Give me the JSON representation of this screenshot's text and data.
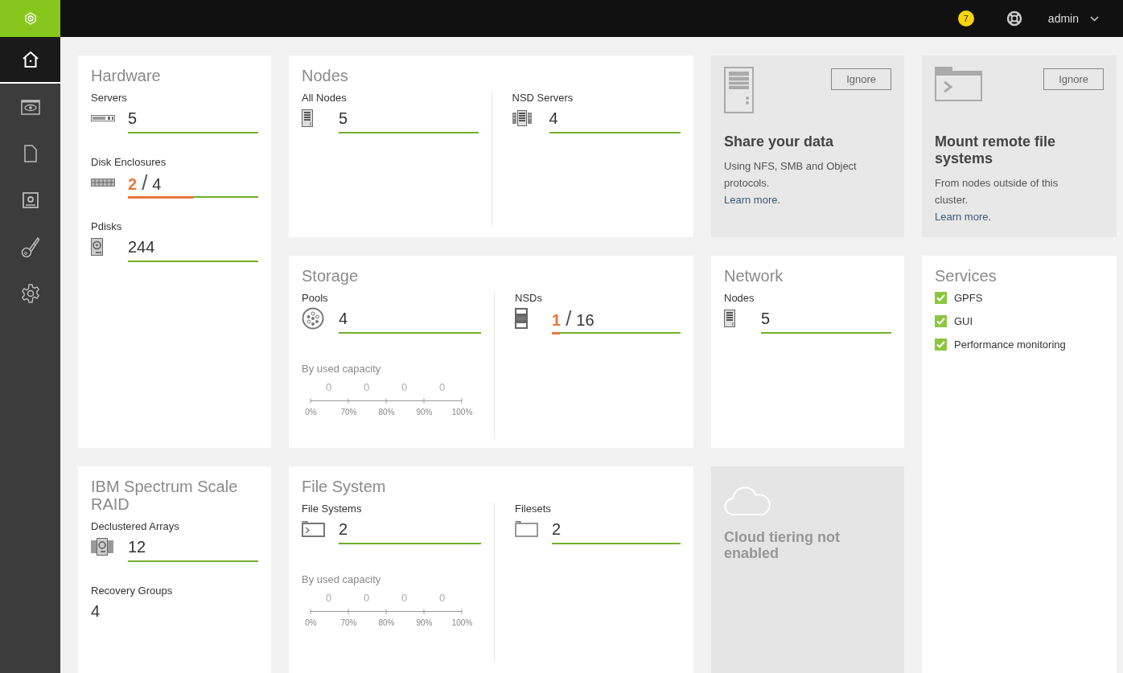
{
  "topbar": {
    "notification_count": "7",
    "user": "admin"
  },
  "sidebar": {
    "items": [
      {
        "selected": true
      },
      {
        "selected": false
      },
      {
        "selected": false
      },
      {
        "selected": false
      },
      {
        "selected": false
      },
      {
        "selected": false
      }
    ]
  },
  "cards": [
    {
      "kind": "metrics",
      "title": "Hardware",
      "metrics": [
        {
          "label": "Servers",
          "value": "5",
          "bar": true
        },
        {
          "label": "Disk Enclosures",
          "value": "2",
          "divider": "/",
          "total": "4",
          "level": 0.5,
          "bar": true
        },
        {
          "label": "Pdisks",
          "value": "244",
          "bar": true
        }
      ]
    },
    {
      "kind": "split",
      "title": "Nodes",
      "metrics": [
        {
          "label": "All Nodes",
          "value": "5",
          "bar": true
        },
        {
          "label": "NSD Servers",
          "value": "4",
          "bar": true
        }
      ]
    },
    {
      "kind": "promo",
      "title": "Share your data",
      "text": "Using NFS, SMB and Object protocols.",
      "link": "Learn more.",
      "button": "Ignore"
    },
    {
      "kind": "promo",
      "title": "Mount remote file systems",
      "text": "From nodes outside of this cluster.",
      "link": "Learn more.",
      "button": "Ignore"
    },
    {
      "kind": "split",
      "title": "Storage",
      "metrics": [
        {
          "label": "Pools",
          "value": "4",
          "bar": true,
          "histogram": {
            "title": "By used capacity",
            "counts": [
              "0",
              "0",
              "0",
              "0"
            ],
            "ticks": [
              "0%",
              "70%",
              "80%",
              "90%",
              "100%"
            ]
          }
        },
        {
          "label": "NSDs",
          "value": "1",
          "divider": "/",
          "total": "16",
          "level": 0.0625,
          "bar": true
        }
      ]
    },
    {
      "kind": "metrics",
      "title": "Network",
      "metrics": [
        {
          "label": "Nodes",
          "value": "5",
          "bar": true
        }
      ]
    },
    {
      "kind": "services",
      "title": "Services",
      "items": [
        {
          "label": "GPFS",
          "checked": true
        },
        {
          "label": "GUI",
          "checked": true
        },
        {
          "label": "Performance monitoring",
          "checked": true
        }
      ]
    },
    {
      "kind": "metrics",
      "title": "IBM Spectrum Scale RAID",
      "metrics": [
        {
          "label": "Declustered Arrays",
          "value": "12",
          "bar": true
        },
        {
          "label": "Recovery Groups",
          "value": "4",
          "bar": false
        }
      ]
    },
    {
      "kind": "split",
      "title": "File System",
      "metrics": [
        {
          "label": "File Systems",
          "value": "2",
          "bar": true,
          "histogram": {
            "title": "By used capacity",
            "counts": [
              "0",
              "0",
              "0",
              "0"
            ],
            "ticks": [
              "0%",
              "70%",
              "80%",
              "90%",
              "100%"
            ]
          }
        },
        {
          "label": "Filesets",
          "value": "2",
          "bar": true
        }
      ]
    },
    {
      "kind": "disabled",
      "title": "Cloud tiering not enabled"
    }
  ]
}
